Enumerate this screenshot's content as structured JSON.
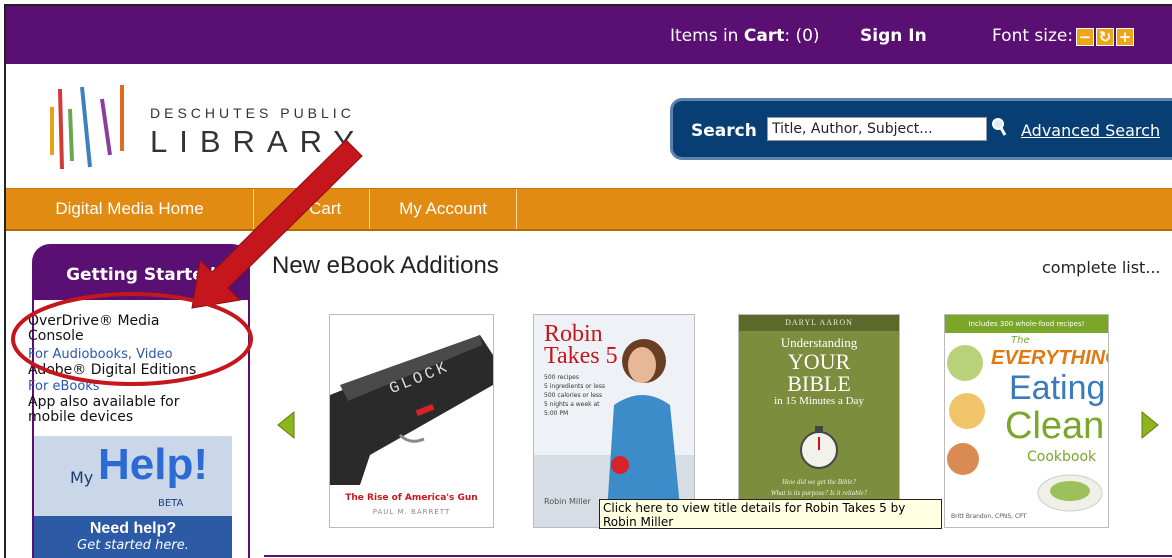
{
  "topbar": {
    "cart_prefix": "Items in ",
    "cart_word": "Cart",
    "cart_count": ": (0)",
    "sign_in": "Sign In",
    "font_size_label": "Font size:",
    "font_buttons": [
      "−",
      "↻",
      "+"
    ]
  },
  "logo": {
    "line1": "DESCHUTES PUBLIC",
    "line2": "LIBRARY",
    "bar_colors": [
      "#e8a21a",
      "#d23b3b",
      "#6aa84f",
      "#3d7fc1",
      "#8a3fa0",
      "#e06a1e"
    ]
  },
  "search": {
    "label": "Search",
    "value": "Title, Author, Subject...",
    "icon": "magnifier-icon",
    "advanced": "Advanced Search"
  },
  "nav": {
    "tabs": [
      "Digital Media Home",
      "My Cart",
      "My Account"
    ]
  },
  "sidebar": {
    "heading": "Getting Started",
    "overdrive_line1": "OverDrive® Media",
    "overdrive_line2": "Console",
    "overdrive_sub": "For Audiobooks, Video",
    "adobe": "Adobe® Digital Editions",
    "adobe_sub": "For eBooks",
    "app_line1": "App also available for",
    "app_line2": "mobile devices",
    "help_my": "My",
    "help_word": "Help!",
    "help_beta": "BETA",
    "help_need": "Need help?",
    "help_started": "Get started here."
  },
  "main": {
    "title": "New eBook Additions",
    "complete_list": "complete list...",
    "books": [
      {
        "title_art": "GLOCK",
        "subtitle": "The Rise of America's Gun",
        "author": "PAUL M. BARRETT"
      },
      {
        "title_line1": "Robin",
        "title_line2": "Takes 5",
        "blurb": [
          "500 recipes",
          "5 ingredients or less",
          "500 calories or less",
          "5 nights a week at",
          "5:00 PM"
        ],
        "author": "Robin Miller"
      },
      {
        "author": "DARYL AARON",
        "line1": "Understanding",
        "line2": "YOUR",
        "line3": "BIBLE",
        "line4": "in 15 Minutes a Day",
        "q1": "How did we get the Bible?",
        "q2": "What is its purpose? Is it reliable?"
      },
      {
        "top": "Includes 300 whole-food recipes!",
        "the": "The",
        "w1": "EVERYTHING",
        "w2": "Eating",
        "w3": "Clean",
        "w4": "Cookbook",
        "author": "Britt Brandon, CPNS, CPT"
      }
    ],
    "tooltip": "Click here to view title details for Robin Takes 5 by Robin Miller"
  },
  "colors": {
    "purple": "#5a0f73",
    "orange": "#e28b12",
    "navy": "#073f74",
    "annotation_red": "#c4161c",
    "carousel_arrow": "#8db51c"
  }
}
